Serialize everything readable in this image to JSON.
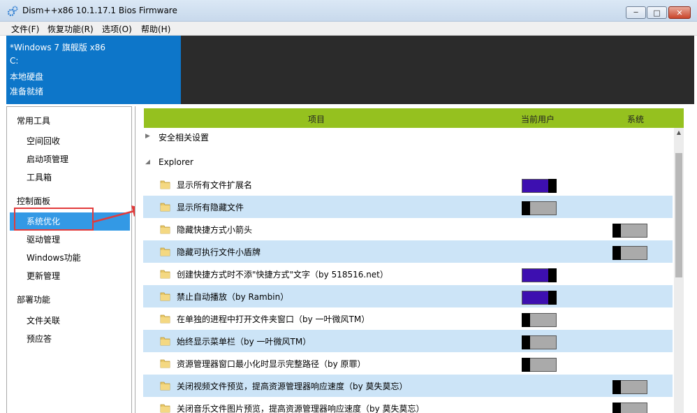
{
  "window": {
    "title": "Dism++x86 10.1.17.1 Bios Firmware",
    "min_glyph": "─",
    "max_glyph": "□",
    "close_glyph": "✕"
  },
  "menu": {
    "items": [
      "文件(F)",
      "恢复功能(R)",
      "选项(O)",
      "帮助(H)"
    ]
  },
  "info": {
    "line1": "*Windows 7 旗舰版 x86",
    "line2": "C:",
    "line3": "本地硬盘",
    "line4": "准备就绪"
  },
  "sidebar": {
    "group1": "常用工具",
    "items1": [
      "空间回收",
      "启动项管理",
      "工具箱"
    ],
    "group2": "控制面板",
    "items2": [
      "系统优化",
      "驱动管理",
      "Windows功能",
      "更新管理"
    ],
    "group3": "部署功能",
    "items3": [
      "文件关联",
      "预应答"
    ],
    "active": "系统优化"
  },
  "columns": {
    "item": "项目",
    "current_user": "当前用户",
    "system": "系统"
  },
  "sections": {
    "security": "安全相关设置",
    "explorer": "Explorer",
    "collapsed_glyph": "▶",
    "expanded_glyph": "◢"
  },
  "rows": [
    {
      "label": "显示所有文件扩展名",
      "user": "on",
      "system": null
    },
    {
      "label": "显示所有隐藏文件",
      "user": "off",
      "system": null
    },
    {
      "label": "隐藏快捷方式小箭头",
      "user": null,
      "system": "off"
    },
    {
      "label": "隐藏可执行文件小盾牌",
      "user": null,
      "system": "off"
    },
    {
      "label": "创建快捷方式时不添\"快捷方式\"文字（by 518516.net）",
      "user": "on",
      "system": null
    },
    {
      "label": "禁止自动播放（by Rambin）",
      "user": "on",
      "system": null
    },
    {
      "label": "在单独的进程中打开文件夹窗口（by 一叶微风TM）",
      "user": "off",
      "system": null
    },
    {
      "label": "始终显示菜单栏（by 一叶微风TM）",
      "user": "off",
      "system": null
    },
    {
      "label": "资源管理器窗口最小化时显示完整路径（by 原罪）",
      "user": "off",
      "system": null
    },
    {
      "label": "关闭视频文件预览，提高资源管理器响应速度（by 莫失莫忘）",
      "user": null,
      "system": "off"
    },
    {
      "label": "关闭音乐文件图片预览，提高资源管理器响应速度（by 莫失莫忘）",
      "user": null,
      "system": "off"
    }
  ],
  "scrollbar": {
    "up_glyph": "▲"
  },
  "colors": {
    "accent_blue": "#0d76c9",
    "header_green": "#95c11f",
    "toggle_on": "#3d0fb0",
    "highlight_row": "#cce4f7",
    "annotation_red": "#e23b3b"
  }
}
